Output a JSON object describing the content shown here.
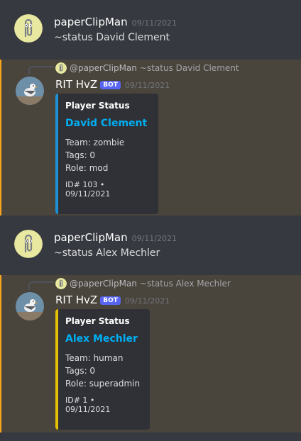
{
  "messages": [
    {
      "author": "paperClipMan",
      "timestamp": "09/11/2021",
      "content": "~status David Clement"
    },
    {
      "reply_to": {
        "mention": "@paperClipMan",
        "text": "~status David Clement"
      },
      "author": "RIT HvZ",
      "badge": "BOT",
      "timestamp": "09/11/2021",
      "embed": {
        "accent_color": "#1e8fd5",
        "author": "Player Status",
        "title": "David Clement",
        "team": "Team: zombie",
        "tags": "Tags: 0",
        "role": "Role: mod",
        "footer": "ID# 103 • 09/11/2021"
      }
    },
    {
      "author": "paperClipMan",
      "timestamp": "09/11/2021",
      "content": "~status Alex Mechler"
    },
    {
      "reply_to": {
        "mention": "@paperClipMan",
        "text": "~status Alex Mechler"
      },
      "author": "RIT HvZ",
      "badge": "BOT",
      "timestamp": "09/11/2021",
      "embed": {
        "accent_color": "#e6c000",
        "author": "Player Status",
        "title": "Alex Mechler",
        "team": "Team: human",
        "tags": "Tags: 0",
        "role": "Role: superadmin",
        "footer": "ID# 1 • 09/11/2021"
      }
    }
  ],
  "icons": {
    "user_avatar": "paperclip-avatar-icon",
    "bot_avatar": "seagull-avatar-icon"
  }
}
